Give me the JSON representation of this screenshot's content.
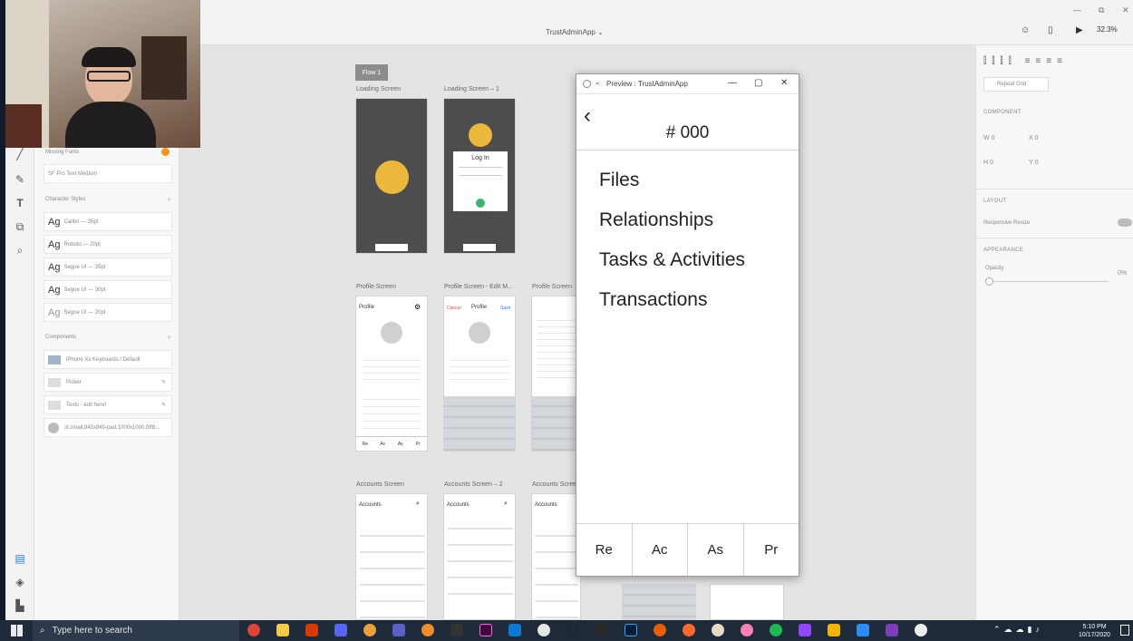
{
  "app": {
    "title": "TrustAdminApp",
    "zoom": "32.3%",
    "window_controls": [
      "—",
      "⧉",
      "✕"
    ]
  },
  "left_panel": {
    "missing_fonts_heading": "Missing Fonts",
    "missing_font": "SF Pro Text Medium",
    "character_styles_heading": "Character Styles",
    "character_styles": [
      {
        "sample": "Ag",
        "name": "Calibri — 35pt"
      },
      {
        "sample": "Ag",
        "name": "Roboto — 20pt"
      },
      {
        "sample": "Ag",
        "name": "Segoe UI — 35pt"
      },
      {
        "sample": "Ag",
        "name": "Segoe UI — 30pt"
      },
      {
        "sample": "Ag",
        "name": "Segoe UI — 20pt"
      }
    ],
    "components_heading": "Components",
    "components": [
      "iPhone Xs Keyboards / Default",
      "Picker",
      "Texts - edit here!",
      "st,small,845x845-pad,1000x1000,f8f8..."
    ]
  },
  "canvas": {
    "flow_tag": "Flow 1",
    "artboards": [
      {
        "label": "Loading Screen"
      },
      {
        "label": "Loading Screen – 1",
        "login_title": "Log In"
      },
      {
        "label": "Profile Screen",
        "header": "Profile"
      },
      {
        "label": "Profile Screen - Edit M...",
        "cancel": "Cancel",
        "header": "Profile",
        "save": "Save"
      },
      {
        "label": "Profile Screen"
      },
      {
        "label": "Accounts Screen",
        "header": "Accounts"
      },
      {
        "label": "Accounts Screen – 2",
        "header": "Accounts"
      },
      {
        "label": "Accounts Scree",
        "header": "Accounts"
      }
    ],
    "profile_tabs": [
      "Re",
      "Ac",
      "As",
      "Pr"
    ]
  },
  "right_panel": {
    "repeat_grid": "Repeat Grid",
    "component_heading": "COMPONENT",
    "w": "0",
    "x": "0",
    "h": "0",
    "y": "0",
    "layout_heading": "LAYOUT",
    "responsive_resize": "Responsive Resize",
    "appearance_heading": "APPEARANCE",
    "opacity_label": "Opacity",
    "opacity_value": "0%"
  },
  "preview": {
    "window_title": "Preview : TrustAdminApp",
    "header_number": "# 000",
    "menu_items": [
      "Files",
      "Relationships",
      "Tasks & Activities",
      "Transactions"
    ],
    "tabs": [
      "Re",
      "Ac",
      "As",
      "Pr"
    ]
  },
  "taskbar": {
    "search_placeholder": "Type here to search",
    "time": "5:10 PM",
    "date": "10/17/2020"
  },
  "colors": {
    "accent_yellow": "#ecb83c",
    "dark_artboard": "#4d4d4d",
    "taskbar": "#1e2a3a"
  }
}
